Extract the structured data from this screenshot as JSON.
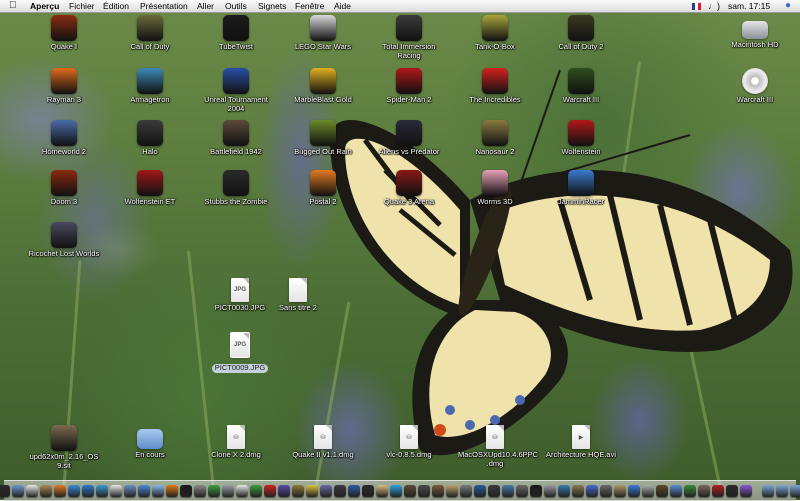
{
  "menubar": {
    "app_name": "Aperçu",
    "items": [
      "Fichier",
      "Édition",
      "Présentation",
      "Aller",
      "Outils",
      "Signets",
      "Fenêtre",
      "Aide"
    ],
    "clock": "sam. 17:15"
  },
  "desktop_icons": [
    {
      "label": "Quake I",
      "icon": "quake-icon",
      "color": "#8a2d12"
    },
    {
      "label": "Call of Duty",
      "icon": "call-of-duty-icon",
      "color": "#6b6a3c"
    },
    {
      "label": "TubeTwist",
      "icon": "tubetwist-icon",
      "color": "#1b1b1b"
    },
    {
      "label": "LEGO Star Wars",
      "icon": "lego-star-wars-icon",
      "color": "#d9d9d9"
    },
    {
      "label": "Total Immersion Racing",
      "icon": "racing-car-icon",
      "color": "#3b3b3b"
    },
    {
      "label": "Tank-O-Box",
      "icon": "tank-icon",
      "color": "#a8a53b"
    },
    {
      "label": "Call of Duty 2",
      "icon": "call-of-duty-2-icon",
      "color": "#3a3a20"
    },
    {
      "label": "Macintosh HD",
      "icon": "hard-drive-icon",
      "color": "#9aa0a6"
    },
    {
      "label": "Rayman 3",
      "icon": "rayman-icon",
      "color": "#e06a1a"
    },
    {
      "label": "Armagetron",
      "icon": "armagetron-icon",
      "color": "#3d88b8"
    },
    {
      "label": "Unreal Tournament 2004",
      "icon": "unreal-tournament-icon",
      "color": "#2a4fa8"
    },
    {
      "label": "MarbleBlast Gold",
      "icon": "marble-icon",
      "color": "#e0b020"
    },
    {
      "label": "Spider-Man 2",
      "icon": "spider-man-icon",
      "color": "#b01818"
    },
    {
      "label": "The Incredibles",
      "icon": "incredibles-icon",
      "color": "#d42020"
    },
    {
      "label": "Warcraft III",
      "icon": "warcraft-icon",
      "color": "#2f4f1e"
    },
    {
      "label": "Warcraft III",
      "icon": "warcraft-disc-icon",
      "color": "#d8d8d8"
    },
    {
      "label": "Homeworld 2",
      "icon": "homeworld-icon",
      "color": "#4a6aa8"
    },
    {
      "label": "Halo",
      "icon": "halo-icon",
      "color": "#3b3b3b"
    },
    {
      "label": "Battlefield 1942",
      "icon": "battlefield-icon",
      "color": "#5a4a3a"
    },
    {
      "label": "Bugged Out Rain",
      "icon": "bugged-out-icon",
      "color": "#6a8a28"
    },
    {
      "label": "Aliens vs Predator",
      "icon": "aliens-predator-icon",
      "color": "#2a2a3a"
    },
    {
      "label": "Nanosaur 2",
      "icon": "nanosaur-icon",
      "color": "#8a7a40"
    },
    {
      "label": "Wolfenstein",
      "icon": "wolfenstein-icon",
      "color": "#b01818"
    },
    {
      "label": "Doom 3",
      "icon": "doom-icon",
      "color": "#8a2a10"
    },
    {
      "label": "Wolfenstein ET",
      "icon": "wolfenstein-et-icon",
      "color": "#a01818"
    },
    {
      "label": "Stubbs the Zombie",
      "icon": "zombie-icon",
      "color": "#2a2a2a"
    },
    {
      "label": "Postal 2",
      "icon": "postal-icon",
      "color": "#e07a20"
    },
    {
      "label": "Quake 3 Arena",
      "icon": "quake-3-icon",
      "color": "#8a1818"
    },
    {
      "label": "Worms 3D",
      "icon": "worms-icon",
      "color": "#e8a0b8"
    },
    {
      "label": "JamminRacer",
      "icon": "jammin-racer-icon",
      "color": "#3a7ad0"
    },
    {
      "label": "Ricochet Lost Worlds",
      "icon": "ricochet-icon",
      "color": "#4a4a60"
    },
    {
      "label": "PICT0030.JPG",
      "icon": "jpeg-document-icon",
      "color": "#ffffff"
    },
    {
      "label": "Sans titre 2",
      "icon": "document-icon",
      "color": "#ffffff"
    },
    {
      "label": "PICT0009.JPG",
      "icon": "jpeg-document-icon",
      "color": "#ffffff"
    },
    {
      "label": "upd62x0m_2.16_OS 9.sit",
      "icon": "stuffit-archive-icon",
      "color": "#7a6a50"
    },
    {
      "label": "En cours",
      "icon": "folder-icon",
      "color": "#7aa6d8"
    },
    {
      "label": "Clone X 2.dmg",
      "icon": "disk-image-icon",
      "color": "#ffffff"
    },
    {
      "label": "Quake II v1.1.dmg",
      "icon": "disk-image-icon",
      "color": "#ffffff"
    },
    {
      "label": "vlc-0.8.5.dmg",
      "icon": "disk-image-icon",
      "color": "#ffffff"
    },
    {
      "label": "MacOSXUpd10.4.6PPC .dmg",
      "icon": "disk-image-icon",
      "color": "#ffffff"
    },
    {
      "label": "Architecture HQE.avi",
      "icon": "video-file-icon",
      "color": "#ffffff"
    }
  ],
  "dock": {
    "items": [
      {
        "name": "finder-icon",
        "color": "#4a88d8"
      },
      {
        "name": "dashboard-icon",
        "color": "#2a2a2a"
      },
      {
        "name": "mail-icon",
        "color": "#6a98d0"
      },
      {
        "name": "ical-icon",
        "color": "#e8e8e8"
      },
      {
        "name": "address-book-icon",
        "color": "#b08a50"
      },
      {
        "name": "firefox-icon",
        "color": "#e07a20"
      },
      {
        "name": "safari-icon",
        "color": "#3a8ad8"
      },
      {
        "name": "ichat-icon",
        "color": "#2a7ad0"
      },
      {
        "name": "globe-icon",
        "color": "#3a9ad0"
      },
      {
        "name": "calendar-icon",
        "color": "#e8e8e8"
      },
      {
        "name": "preview-icon",
        "color": "#6a90c0"
      },
      {
        "name": "iphoto-icon",
        "color": "#4a8ad8"
      },
      {
        "name": "itunes-icon",
        "color": "#8ab8e8"
      },
      {
        "name": "vlc-icon",
        "color": "#e07a10"
      },
      {
        "name": "terminal-icon",
        "color": "#1a1a1a"
      },
      {
        "name": "system-preferences-icon",
        "color": "#8a8a8a"
      },
      {
        "name": "activity-monitor-icon",
        "color": "#3aa040"
      },
      {
        "name": "disk-utility-icon",
        "color": "#9aa0a6"
      },
      {
        "name": "textedit-icon",
        "color": "#e8e8e8"
      },
      {
        "name": "adium-icon",
        "color": "#3a9a40"
      },
      {
        "name": "transmission-icon",
        "color": "#d02020"
      },
      {
        "name": "camino-icon",
        "color": "#5a4aa8"
      },
      {
        "name": "stuffit-icon",
        "color": "#8a7a3a"
      },
      {
        "name": "garageband-icon",
        "color": "#e0c040"
      },
      {
        "name": "imovie-icon",
        "color": "#6a6aa8"
      },
      {
        "name": "idvd-icon",
        "color": "#3a3a3a"
      },
      {
        "name": "photoshop-icon",
        "color": "#2a5aa8"
      },
      {
        "name": "mplayer-icon",
        "color": "#2a2a2a"
      },
      {
        "name": "cyberduck-icon",
        "color": "#d8c080"
      },
      {
        "name": "skype-icon",
        "color": "#2aa0e0"
      },
      {
        "name": "dictionary-icon",
        "color": "#5a4a3a"
      },
      {
        "name": "calculator-icon",
        "color": "#4a4a4a"
      },
      {
        "name": "chess-icon",
        "color": "#7a5a3a"
      },
      {
        "name": "font-book-icon",
        "color": "#c0a070"
      },
      {
        "name": "image-capture-icon",
        "color": "#7a7a7a"
      },
      {
        "name": "quicktime-icon",
        "color": "#2a5aa0"
      },
      {
        "name": "dvd-player-icon",
        "color": "#3a3a3a"
      },
      {
        "name": "network-icon",
        "color": "#4a78a8"
      },
      {
        "name": "printer-icon",
        "color": "#6a6a6a"
      },
      {
        "name": "console-icon",
        "color": "#1a1a1a"
      },
      {
        "name": "automator-icon",
        "color": "#9a9aa8"
      },
      {
        "name": "grapher-icon",
        "color": "#3a7ab0"
      },
      {
        "name": "sherlock-icon",
        "color": "#8a7a50"
      },
      {
        "name": "xcode-icon",
        "color": "#4a6ad0"
      },
      {
        "name": "interface-builder-icon",
        "color": "#6a6a6a"
      },
      {
        "name": "keychain-icon",
        "color": "#b09a60"
      },
      {
        "name": "bluetooth-icon",
        "color": "#3a7ad8"
      },
      {
        "name": "airport-icon",
        "color": "#b0b0b0"
      },
      {
        "name": "world-of-warcraft-icon",
        "color": "#5a4a2a"
      },
      {
        "name": "itunes-music-store-icon",
        "color": "#5a8ad0"
      },
      {
        "name": "neooffice-icon",
        "color": "#3a8a3a"
      },
      {
        "name": "gimp-icon",
        "color": "#7a6a5a"
      },
      {
        "name": "photo-booth-icon",
        "color": "#b02020"
      },
      {
        "name": "front-row-icon",
        "color": "#2a2a2a"
      },
      {
        "name": "app-icon-purple",
        "color": "#8a5ad0"
      },
      {
        "name": "downloads-folder-icon",
        "color": "#7aa6d8"
      },
      {
        "name": "documents-folder-icon",
        "color": "#7aa6d8"
      },
      {
        "name": "applications-folder-icon",
        "color": "#7aa6d8"
      },
      {
        "name": "trash-icon",
        "color": "#c0c0c0"
      }
    ]
  }
}
